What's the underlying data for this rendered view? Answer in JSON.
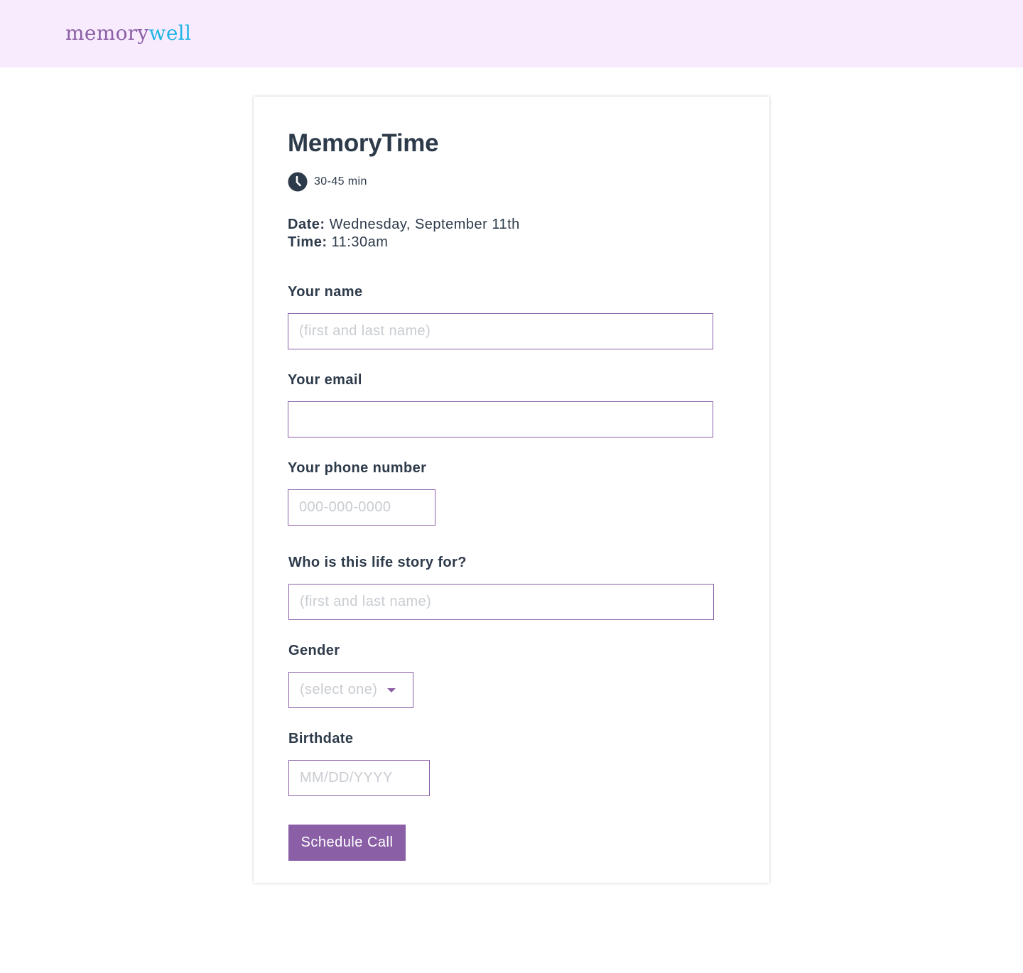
{
  "header": {
    "logo_part1": "memory",
    "logo_part2": "well",
    "background": "#f9ebfe"
  },
  "event": {
    "title": "MemoryTime",
    "duration": "30-45 min",
    "date_label": "Date:",
    "date_value": "Wednesday, September 11th",
    "time_label": "Time:",
    "time_value": "11:30am"
  },
  "form": {
    "name": {
      "label": "Your name",
      "placeholder": "(first and last name)",
      "value": ""
    },
    "email": {
      "label": "Your email",
      "placeholder": "",
      "value": ""
    },
    "phone": {
      "label": "Your phone number",
      "placeholder": "000-000-0000",
      "value": ""
    },
    "subject": {
      "label": "Who is this life story for?",
      "placeholder": "(first and last name)",
      "value": ""
    },
    "gender": {
      "label": "Gender",
      "selected": "(select one)"
    },
    "birthdate": {
      "label": "Birthdate",
      "placeholder": "MM/DD/YYYY",
      "value": ""
    },
    "submit_label": "Schedule Call"
  },
  "colors": {
    "accent": "#8a5fa6",
    "logo_secondary": "#1fb6e5",
    "text": "#2d3a4a",
    "placeholder": "#c9ccd1"
  }
}
